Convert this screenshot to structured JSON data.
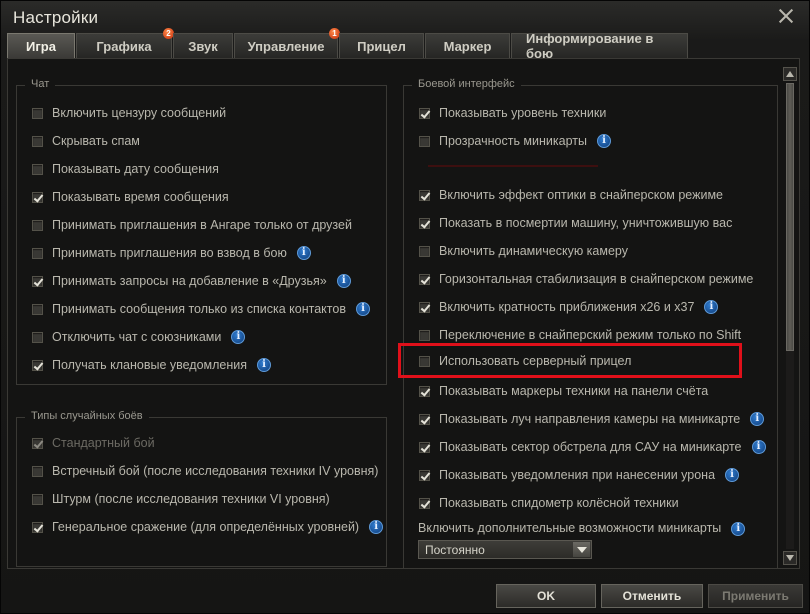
{
  "window": {
    "title": "Настройки"
  },
  "tabs": [
    {
      "label": "Игра",
      "active": true
    },
    {
      "label": "Графика",
      "badge": "2"
    },
    {
      "label": "Звук"
    },
    {
      "label": "Управление",
      "badge": "1"
    },
    {
      "label": "Прицел"
    },
    {
      "label": "Маркер"
    },
    {
      "label": "Информирование в бою"
    }
  ],
  "chat": {
    "title": "Чат",
    "items": [
      {
        "label": "Включить цензуру сообщений",
        "checked": false
      },
      {
        "label": "Скрывать спам",
        "checked": false
      },
      {
        "label": "Показывать дату сообщения",
        "checked": false
      },
      {
        "label": "Показывать время сообщения",
        "checked": true
      },
      {
        "label": "Принимать приглашения в Ангаре только от друзей",
        "checked": false
      },
      {
        "label": "Принимать приглашения во взвод в бою",
        "checked": false
      },
      {
        "label": "Принимать запросы на добавление в «Друзья»",
        "checked": true
      },
      {
        "label": "Принимать сообщения только из списка контактов",
        "checked": false
      },
      {
        "label": "Отключить чат с союзниками",
        "checked": false
      },
      {
        "label": "Получать клановые уведомления",
        "checked": true
      }
    ]
  },
  "battle_types": {
    "title": "Типы случайных боёв",
    "items": [
      {
        "label": "Стандартный бой",
        "checked": true,
        "disabled": true
      },
      {
        "label": "Встречный бой (после исследования техники IV уровня)",
        "checked": false
      },
      {
        "label": "Штурм (после исследования техники VI уровня)",
        "checked": false
      },
      {
        "label": "Генеральное сражение (для определённых уровней)",
        "checked": true
      }
    ]
  },
  "battle_interface": {
    "title": "Боевой интерфейс",
    "items": [
      {
        "label": "Показывать уровень техники",
        "checked": true
      },
      {
        "label": "Прозрачность миникарты",
        "checked": false
      },
      {
        "label": "Включить эффект оптики в снайперском режиме",
        "checked": true
      },
      {
        "label": "Показать в посмертии машину, уничтожившую вас",
        "checked": true
      },
      {
        "label": "Включить динамическую камеру",
        "checked": false
      },
      {
        "label": "Горизонтальная стабилизация в снайперском режиме",
        "checked": true
      },
      {
        "label": "Включить кратность приближения х26 и х37",
        "checked": true
      },
      {
        "label": "Переключение в снайперский режим только по Shift",
        "checked": false
      },
      {
        "label": "Использовать серверный прицел",
        "checked": false
      },
      {
        "label": "Показывать маркеры техники на панели счёта",
        "checked": true
      },
      {
        "label": "Показывать луч направления камеры на миникарте",
        "checked": true
      },
      {
        "label": "Показывать сектор обстрела для САУ на миникарте",
        "checked": true
      },
      {
        "label": "Показывать уведомления при нанесении урона",
        "checked": true
      },
      {
        "label": "Показывать спидометр колёсной техники",
        "checked": true
      }
    ],
    "minimap_extra_label": "Включить дополнительные возможности миникарты",
    "minimap_extra_value": "Постоянно"
  },
  "icons": {
    "info": "i"
  },
  "buttons": {
    "ok": "OK",
    "cancel": "Отменить",
    "apply": "Применить"
  }
}
